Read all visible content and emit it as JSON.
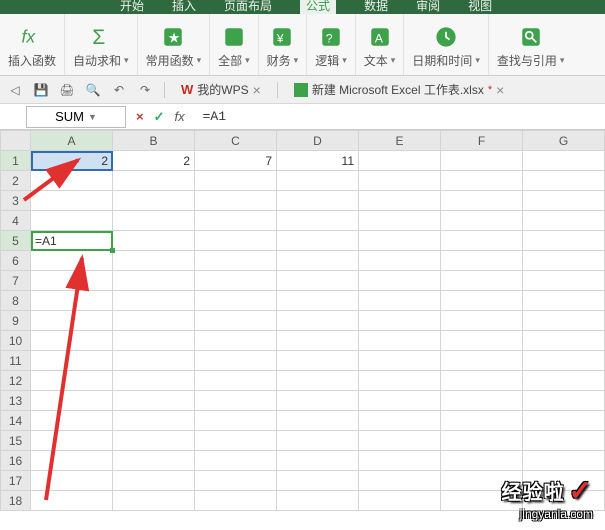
{
  "menu": {
    "tabs": [
      "开始",
      "插入",
      "页面布局",
      "公式",
      "数据",
      "审阅",
      "视图"
    ],
    "active_index": 3
  },
  "ribbon": {
    "insert_fn": "插入函数",
    "autosum": "自动求和",
    "common": "常用函数",
    "all": "全部",
    "financial": "财务",
    "logical": "逻辑",
    "text": "文本",
    "datetime": "日期和时间",
    "lookup": "查找与引用"
  },
  "qat": {
    "mywps": "我的WPS",
    "filename": "新建 Microsoft Excel 工作表.xlsx"
  },
  "formula_bar": {
    "namebox": "SUM",
    "cancel": "×",
    "accept": "✓",
    "fx": "fx",
    "input": "=A1"
  },
  "grid": {
    "cols": [
      "A",
      "B",
      "C",
      "D",
      "E",
      "F",
      "G"
    ],
    "rows": 18,
    "cells": {
      "A1": "2",
      "B1": "2",
      "C1": "7",
      "D1": "11",
      "A5": "=A1"
    },
    "ref_cell": "A1",
    "edit_cell": "A5"
  },
  "watermark": {
    "main": "经验啦",
    "sub": "jingyanla.com"
  }
}
